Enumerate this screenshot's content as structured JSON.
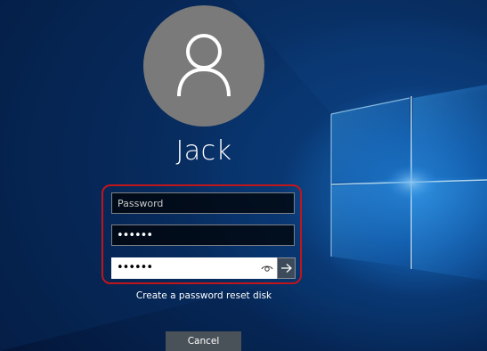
{
  "user": {
    "name": "Jack",
    "avatar_icon": "person-icon"
  },
  "fields": {
    "password_placeholder": "Password",
    "new_password_value": "••••••",
    "confirm_password_value": "••••••",
    "reveal_icon": "eye-icon",
    "submit_icon": "arrow-right-icon"
  },
  "links": {
    "reset_disk": "Create a password reset disk"
  },
  "buttons": {
    "cancel": "Cancel"
  },
  "colors": {
    "highlight": "#c0161b",
    "avatar_bg": "#7a7a7a",
    "cancel_bg": "#4a5259"
  }
}
